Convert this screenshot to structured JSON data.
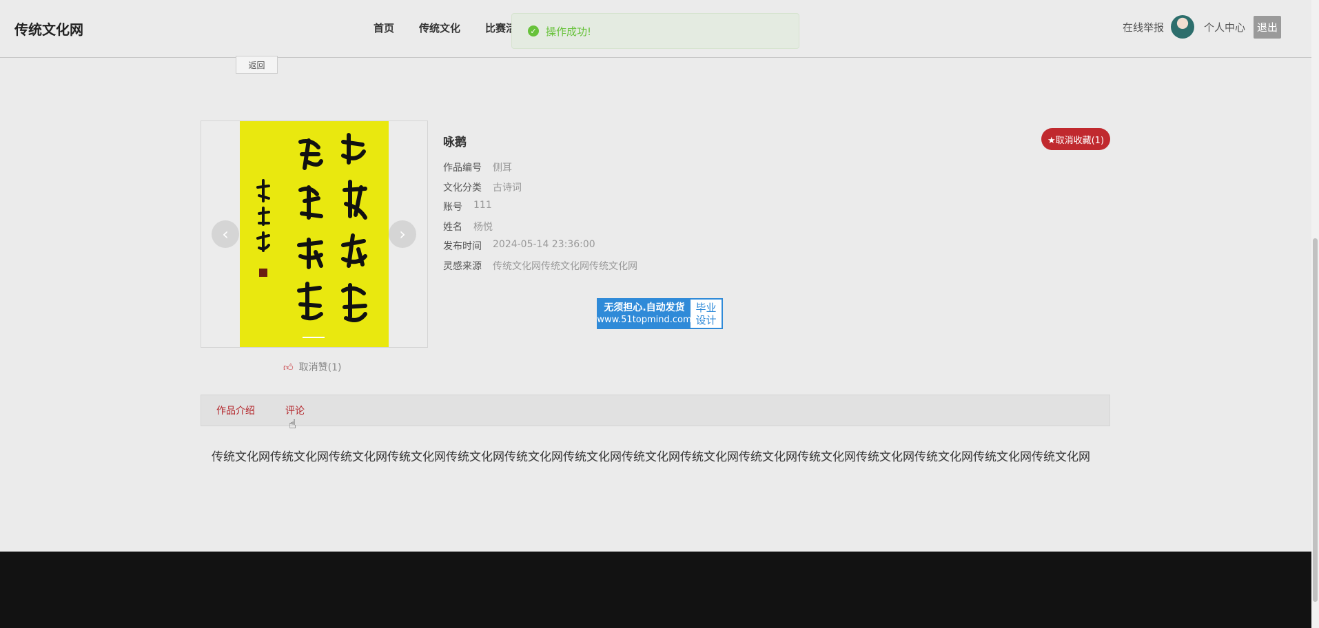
{
  "header": {
    "logo": "传统文化网",
    "nav": [
      "首页",
      "传统文化",
      "比赛活"
    ],
    "report_label": "在线举报",
    "center_label": "个人中心",
    "logout_label": "退出"
  },
  "toast": {
    "message": "操作成功!"
  },
  "back_label": "返回",
  "gallery": {
    "poster_color": "#e9e80f",
    "prev_icon": "‹",
    "next_icon": "›"
  },
  "like": {
    "label": "取消赞(1)"
  },
  "work": {
    "title": "咏鹅",
    "favorite_label": "★取消收藏(1)",
    "fields": [
      {
        "label": "作品编号",
        "value": "侧耳"
      },
      {
        "label": "文化分类",
        "value": "古诗词"
      },
      {
        "label": "账号",
        "value": "111"
      },
      {
        "label": "姓名",
        "value": "杨悦"
      },
      {
        "label": "发布时间",
        "value": "2024-05-14 23:36:00"
      },
      {
        "label": "灵感来源",
        "value": "传统文化网传统文化网传统文化网"
      }
    ]
  },
  "ad": {
    "line1": "无须担心.自动发货",
    "line2": "www.51topmind.com",
    "right1": "毕业",
    "right2": "设计"
  },
  "tabs": [
    "作品介绍",
    "评论"
  ],
  "content": "传统文化网传统文化网传统文化网传统文化网传统文化网传统文化网传统文化网传统文化网传统文化网传统文化网传统文化网传统文化网传统文化网传统文化网传统文化网",
  "colors": {
    "accent": "#c0292e",
    "tab_text": "#b4282d",
    "success": "#67c23a",
    "footer": "#121212"
  }
}
